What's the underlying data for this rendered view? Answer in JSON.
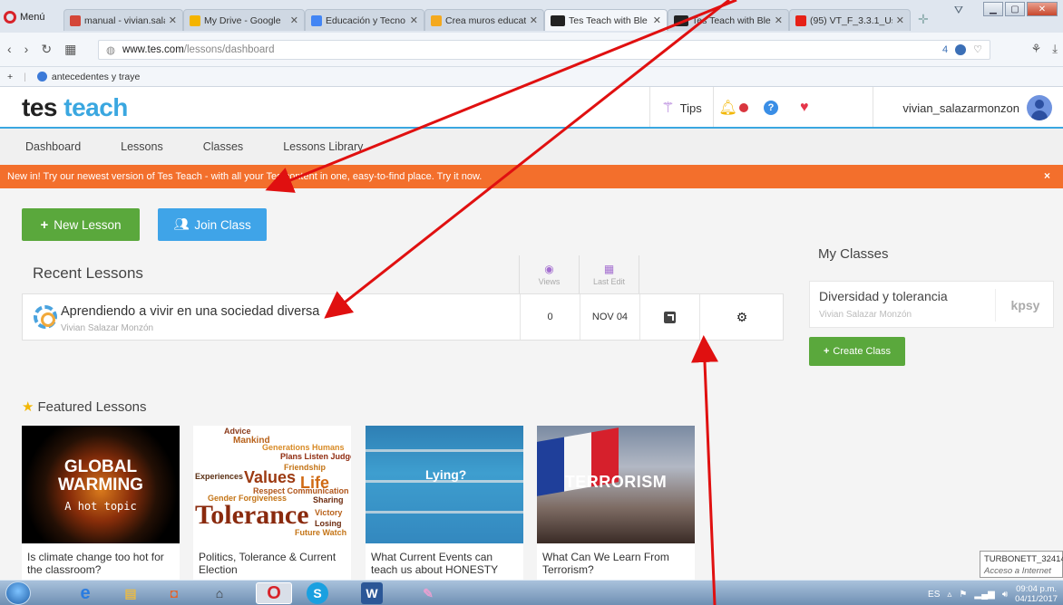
{
  "browser": {
    "menu_label": "Menú",
    "tabs": [
      {
        "title": "manual - vivian.sala",
        "favicon_color": "#d44638"
      },
      {
        "title": "My Drive - Google",
        "favicon_color": "#f4b400"
      },
      {
        "title": "Educación y Tecno",
        "favicon_color": "#4285f4"
      },
      {
        "title": "Crea muros educat",
        "favicon_color": "#f4a91e"
      },
      {
        "title": "Tes Teach with Ble",
        "favicon_color": "#222222"
      },
      {
        "title": "Tes Teach with Ble",
        "favicon_color": "#222222"
      },
      {
        "title": "(95) VT_F_3.3.1_Us",
        "favicon_color": "#e62117"
      }
    ],
    "url_host": "www.tes.com",
    "url_path": "/lessons/dashboard",
    "url_badge": "4",
    "bookmark": "antecedentes y traye"
  },
  "header": {
    "logo_tes": "tes",
    "logo_teach": "teach",
    "tips_label": "Tips",
    "username": "vivian_salazarmonzon"
  },
  "subnav": [
    "Dashboard",
    "Lessons",
    "Classes",
    "Lessons Library"
  ],
  "banner": {
    "text": "New in! Try our newest version of Tes Teach - with all your Tes content in one, easy-to-find place. Try it now.",
    "close": "×"
  },
  "actions": {
    "new_lesson": "New Lesson",
    "join_class": "Join Class"
  },
  "recent": {
    "title": "Recent Lessons",
    "col_views": "Views",
    "col_last_edit": "Last Edit",
    "lessons": [
      {
        "title": "Aprendiendo a vivir en una sociedad diversa",
        "author": "Vivian Salazar Monzón",
        "views": "0",
        "last_edit": "NOV 04"
      }
    ]
  },
  "my_classes": {
    "title": "My Classes",
    "classes": [
      {
        "name": "Diversidad y tolerancia",
        "author": "Vivian Salazar Monzón",
        "code": "kpsy"
      }
    ],
    "create_label": "Create Class"
  },
  "featured": {
    "title": "Featured Lessons",
    "cards": [
      {
        "caption": "Is climate change too hot for the classroom?",
        "img_title": "GLOBAL WARMING",
        "img_sub": "A hot topic"
      },
      {
        "caption": "Politics, Tolerance & Current Election",
        "img_title": "Tolerance",
        "img_sub": "Values"
      },
      {
        "caption": "What Current Events can teach us about HONESTY",
        "img_title": "Lying?",
        "img_sub": ""
      },
      {
        "caption": "What Can We Learn From Terrorism?",
        "img_title": "TERRORISM",
        "img_sub": ""
      }
    ]
  },
  "tooltip": {
    "line1": "TURBONETT_32414",
    "line2": "Acceso a Internet"
  },
  "taskbar": {
    "lang": "ES",
    "time": "09:04 p.m.",
    "date": "04/11/2017"
  }
}
